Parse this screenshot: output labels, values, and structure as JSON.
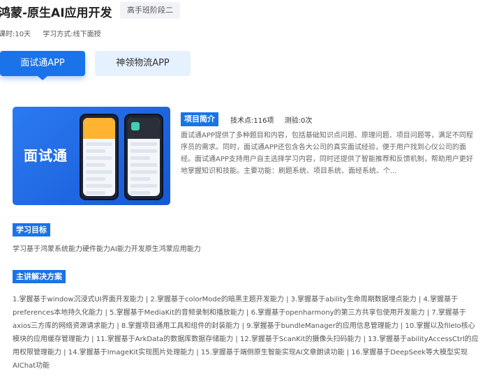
{
  "course": {
    "title": "鸿蒙-原生AI应用开发",
    "stage_badge": "高手班阶段二",
    "duration": "课时:10天",
    "study_mode": "学习方式:线下面授"
  },
  "tabs": [
    {
      "label": "面试通APP",
      "active": true
    },
    {
      "label": "神领物流APP",
      "active": false
    }
  ],
  "project": {
    "cover_text": "面试通",
    "intro_tag": "项目简介",
    "tech_points": "技术点:116项",
    "tests": "测验:0次",
    "description": "面试通APP提供了多种题目和内容，包括基础知识点问题、原理问题、项目问题等，满足不同程序员的需求。同时，面试通APP还包含各大公司的真实面试经验，便于用户找到心仪公司的面经。面试通APP支持用户自主选择学习内容，同时还提供了智能推荐和反馈机制，帮助用户更好地掌握知识和技能。主要功能：刷题系统、项目系统、面经系统、个..."
  },
  "goal": {
    "tag": "学习目标",
    "text": "学习基于鸿蒙系统能力硬件能力AI能力开发原生鸿蒙应用能力"
  },
  "solution": {
    "tag": "主讲解决方案",
    "text": "1.掌握基于window沉浸式UI界面开发能力 | 2.掌握基于colorMode的暗黑主题开发能力 | 3.掌握基于ability生命周期数据埋点能力 | 4.掌握基于preferences本地持久化能力 | 5.掌握基于MediaKit的音频录制和播放能力 | 6.掌握基于openharmony的第三方共享包使用开发能力 | 7.掌握基于axios三方库的网络资源请求能力 | 8.掌握项目通用工具和组件的封装能力 | 9.掌握基于bundleManager的应用信息管理能力 | 10.掌握以及fileIo核心模块的应用缓存管理能力 | 11.掌握基于ArkData的数据库数据存储能力 | 12.掌握基于ScanKit的摄像头扫码能力 | 13.掌握基于abilityAccessCtrl的应用权限管理能力 | 14.掌握基于ImageKit实现图片处理能力 | 15.掌握基于端侧原生智能实现AI文章朗读功能 | 16.掌握基于DeepSeek等大模型实现AIChat功能"
  },
  "colors": {
    "accent": "#1a73e8",
    "tab_inactive_bg": "#e6f1ff",
    "badge_bg": "#f1f3f7"
  }
}
